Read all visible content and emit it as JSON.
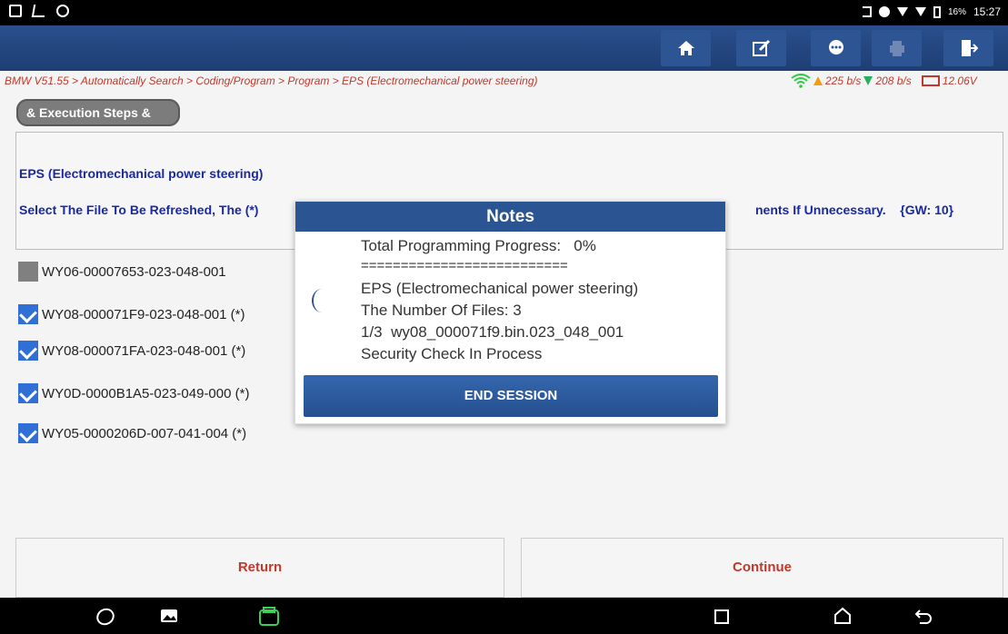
{
  "status_bar": {
    "battery": "16%",
    "time": "15:27"
  },
  "toolbar": {
    "buttons": [
      "home-icon",
      "edit-icon",
      "chat-icon",
      "print-icon",
      "exit-icon"
    ]
  },
  "breadcrumb": "BMW V51.55 > Automatically Search > Coding/Program > Program > EPS (Electromechanical power steering)",
  "network": {
    "upload": "225 b/s",
    "download": "208 b/s",
    "voltage": "12.06V"
  },
  "steps_pill": "& Execution Steps &",
  "info": {
    "module": "EPS (Electromechanical power steering)",
    "instruction_start": "Select The File To Be Refreshed, The (*)",
    "instruction_end": "nents If Unnecessary.",
    "gw": "{GW: 10}"
  },
  "files": [
    {
      "label": "WY06-00007653-023-048-001",
      "checked": false
    },
    {
      "label": "WY08-000071F9-023-048-001  (*)",
      "checked": true
    },
    {
      "label": "WY08-000071FA-023-048-001  (*)",
      "checked": true
    },
    {
      "label": "WY0D-0000B1A5-023-049-000  (*)",
      "checked": true
    },
    {
      "label": "WY05-0000206D-007-041-004  (*)",
      "checked": true
    }
  ],
  "buttons": {
    "return": "Return",
    "continue": "Continue"
  },
  "dialog": {
    "title": "Notes",
    "lines": [
      "Total Programming Progress:   0%",
      "==========================",
      "EPS (Electromechanical power steering)",
      "The Number Of Files: 3",
      "1/3  wy08_000071f9.bin.023_048_001",
      "Security Check In Process"
    ],
    "end_button": "END SESSION"
  }
}
